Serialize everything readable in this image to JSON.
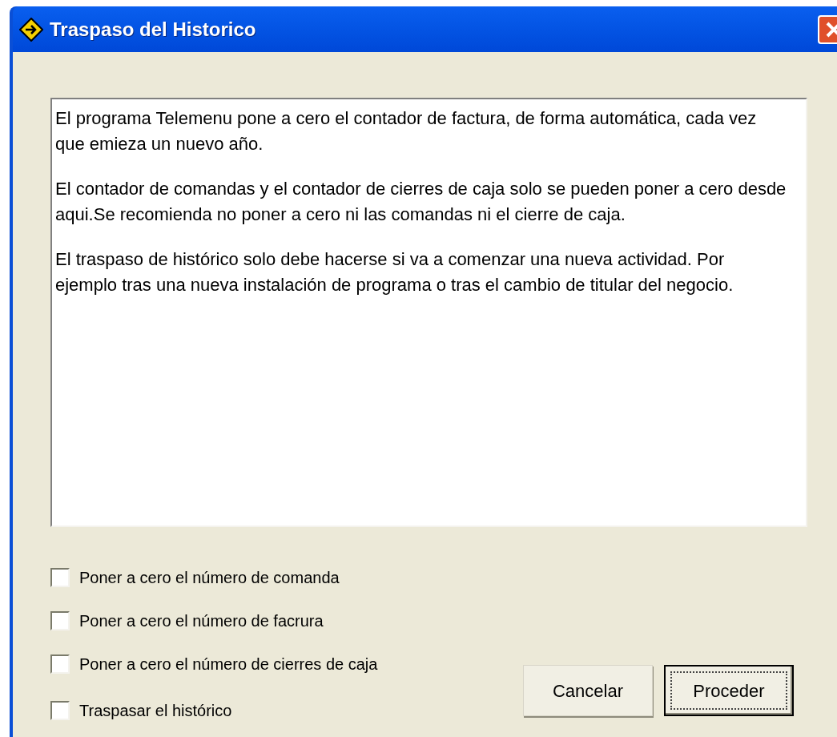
{
  "window": {
    "title": "Traspaso del Historico"
  },
  "message": {
    "paragraphs": [
      "El programa Telemenu pone a cero el contador de factura, de forma automática, cada vez que emieza un nuevo año.",
      "El contador de comandas y el contador de cierres de caja solo se pueden poner a cero desde aqui.Se recomienda no poner a cero ni las comandas ni el cierre de caja.",
      "El traspaso de histórico solo debe hacerse si va a comenzar una nueva actividad. Por ejemplo tras una nueva instalación de programa o tras el cambio de titular del negocio."
    ]
  },
  "options": [
    {
      "label": "Poner a cero el número de comanda",
      "checked": false
    },
    {
      "label": "Poner a cero el número de facrura",
      "checked": false
    },
    {
      "label": "Poner a cero el número de cierres de caja",
      "checked": false
    },
    {
      "label": "Traspasar el histórico",
      "checked": false
    }
  ],
  "buttons": [
    {
      "label": "Cancelar",
      "default": false
    },
    {
      "label": "Proceder",
      "default": true
    }
  ]
}
